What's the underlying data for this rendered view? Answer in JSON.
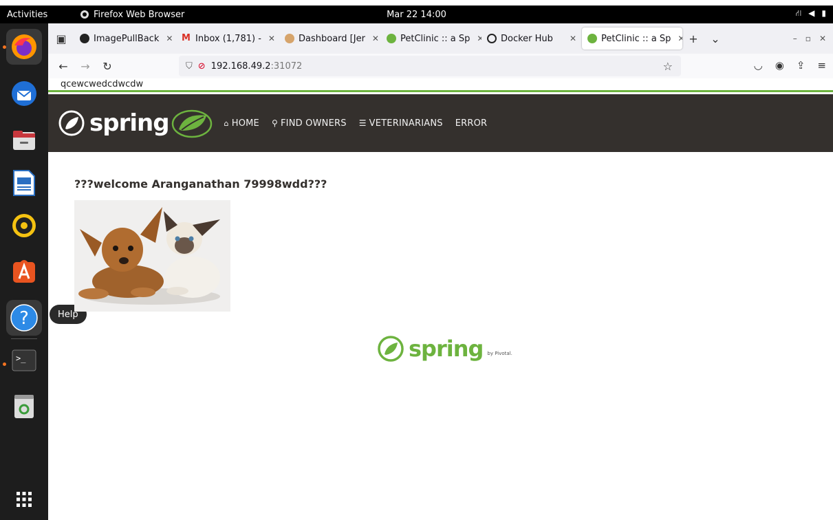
{
  "system": {
    "activities": "Activities",
    "app_name": "Firefox Web Browser",
    "clock": "Mar 22  14:00"
  },
  "dock": {
    "tooltip": "Help",
    "items": [
      "firefox",
      "thunderbird",
      "files",
      "libreoffice-writer",
      "rhythmbox",
      "app-center",
      "help",
      "terminal",
      "trash",
      "show-apps"
    ]
  },
  "browser": {
    "tabs": [
      {
        "label": "ImagePullBack",
        "icon": "github-icon"
      },
      {
        "label": "Inbox (1,781) - ",
        "icon": "gmail-icon"
      },
      {
        "label": "Dashboard [Jer",
        "icon": "jenkins-icon"
      },
      {
        "label": "PetClinic :: a Sp",
        "icon": "spring-icon"
      },
      {
        "label": "Docker Hub",
        "icon": "docker-icon"
      },
      {
        "label": "PetClinic :: a Sp",
        "icon": "spring-icon",
        "selected": true
      }
    ],
    "url_host": "192.168.49.2",
    "url_port": ":31072"
  },
  "page": {
    "banner_text": "qcewcwedcdwcdw",
    "brand": "spring",
    "nav": [
      {
        "label": "HOME",
        "icon": "home-icon"
      },
      {
        "label": "FIND OWNERS",
        "icon": "search-icon"
      },
      {
        "label": "VETERINARIANS",
        "icon": "list-icon"
      },
      {
        "label": "ERROR",
        "icon": ""
      }
    ],
    "welcome": "???welcome Aranganathan 79998wdd???",
    "footer_brand": "spring",
    "footer_by": "by Pivotal."
  },
  "colors": {
    "spring_green": "#6db33f",
    "nav_bg": "#34302d"
  }
}
